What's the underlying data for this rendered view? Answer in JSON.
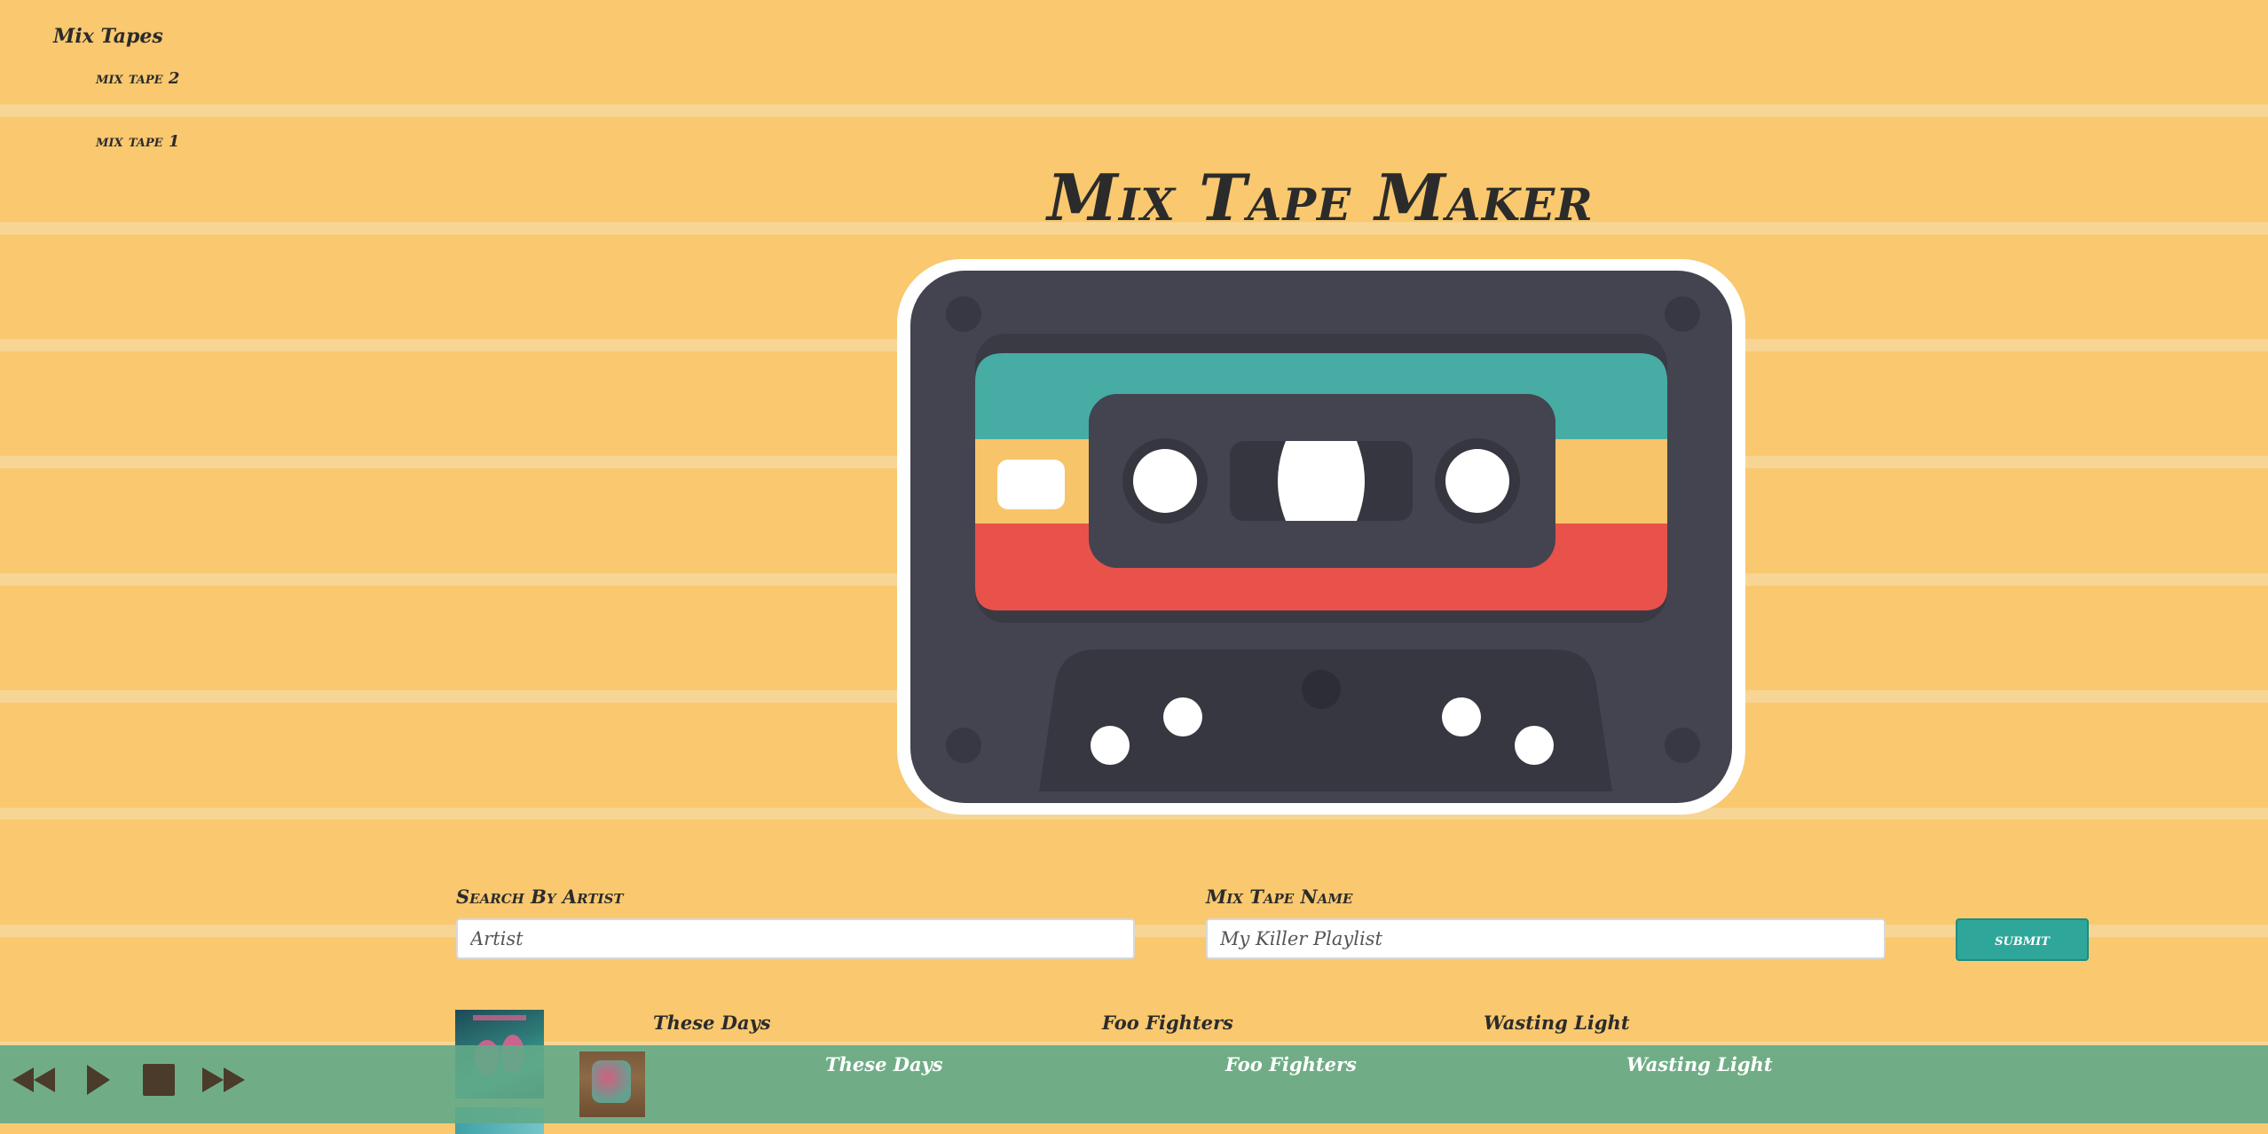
{
  "sidebar": {
    "title": "Mix Tapes",
    "items": [
      {
        "label": "mix tape 2"
      },
      {
        "label": "mix tape 1"
      }
    ]
  },
  "page": {
    "title": "Mix Tape Maker"
  },
  "form": {
    "artist_label": "Search By Artist",
    "artist_placeholder": "Artist",
    "name_label": "Mix Tape Name",
    "name_placeholder": "My Killer Playlist",
    "submit_label": "submit"
  },
  "results": [
    {
      "song": "These Days",
      "artist": "Foo Fighters",
      "album": "Wasting Light"
    }
  ],
  "player": {
    "icons": [
      "rewind-icon",
      "play-icon",
      "stop-icon",
      "fast-forward-icon"
    ],
    "now_playing": {
      "song": "These Days",
      "artist": "Foo Fighters",
      "album": "Wasting Light"
    }
  },
  "colors": {
    "background": "#f9c86f",
    "cassette_body": "#43444f",
    "stripe_teal": "#47aca3",
    "stripe_yellow": "#f7c469",
    "stripe_red": "#e9524a",
    "submit": "#2ea79a",
    "player_bar": "#60aa88"
  }
}
